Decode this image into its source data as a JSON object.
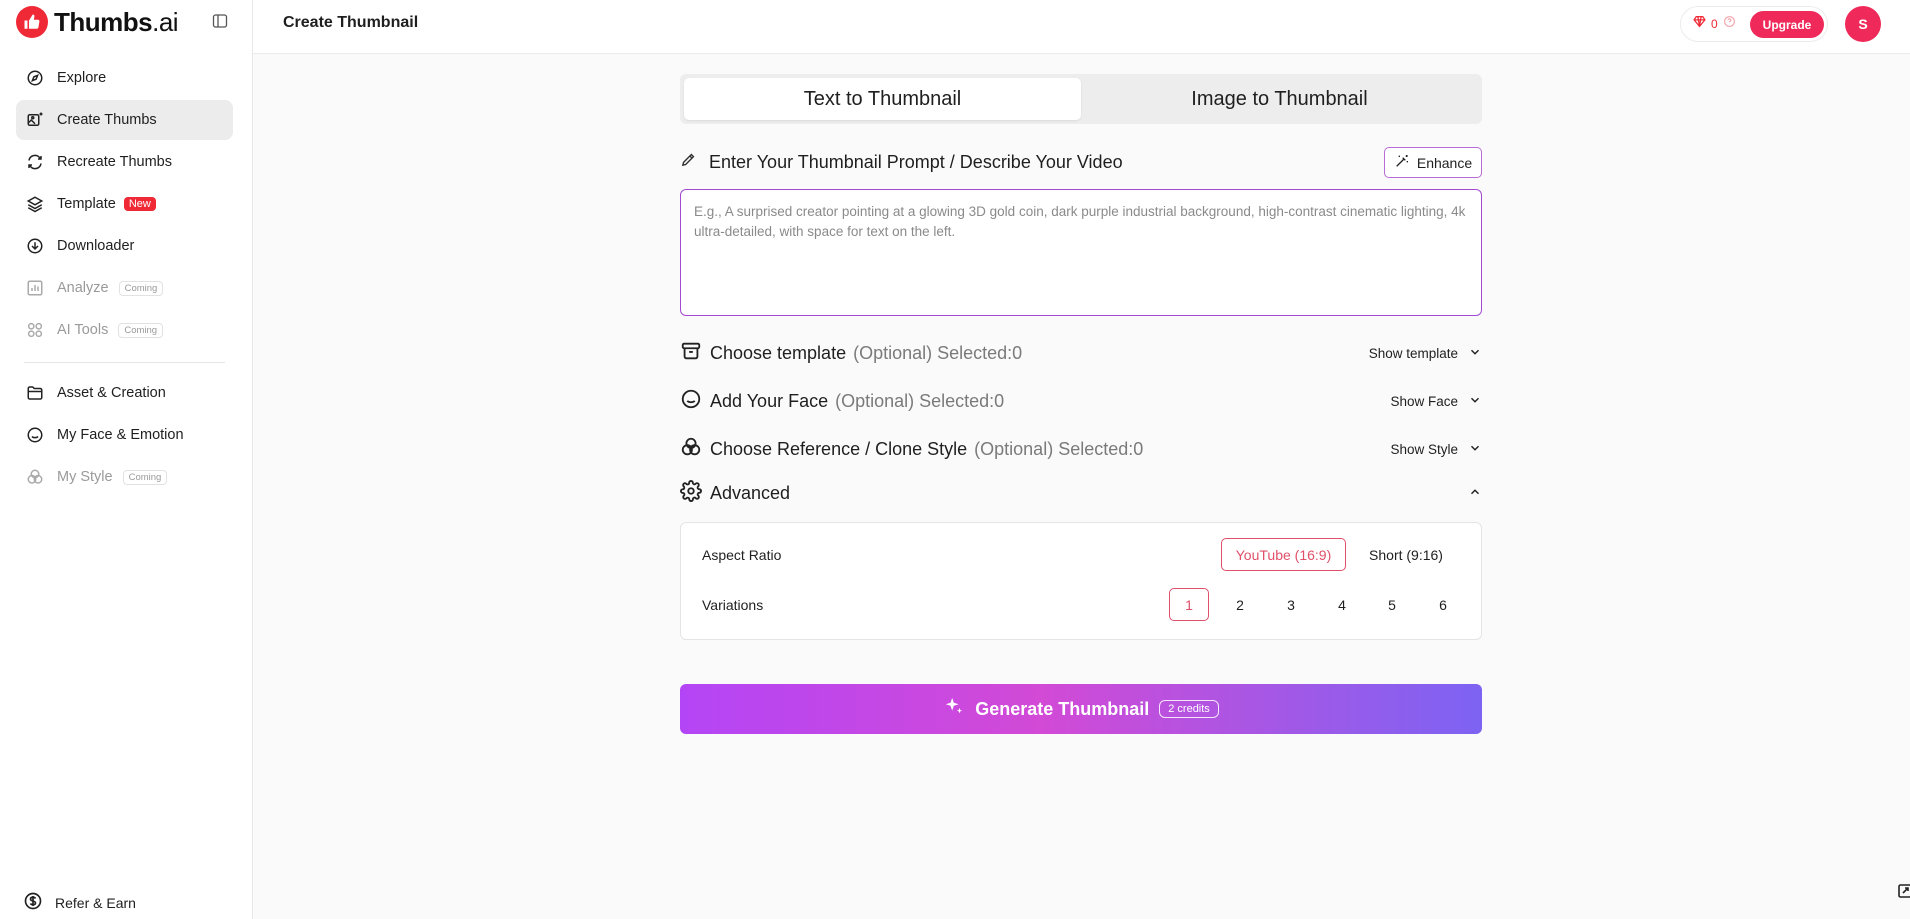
{
  "brand": {
    "name": "Thumbs",
    "suffix": ".ai"
  },
  "header": {
    "title": "Create Thumbnail",
    "credits": "0",
    "upgrade_label": "Upgrade",
    "avatar_initial": "S"
  },
  "sidebar": {
    "items": [
      {
        "label": "Explore",
        "icon": "compass-icon"
      },
      {
        "label": "Create Thumbs",
        "icon": "image-sparkle-icon"
      },
      {
        "label": "Recreate Thumbs",
        "icon": "refresh-icon"
      },
      {
        "label": "Template",
        "icon": "layers-icon",
        "badge": "New"
      },
      {
        "label": "Downloader",
        "icon": "download-circle-icon"
      },
      {
        "label": "Analyze",
        "icon": "bar-chart-icon",
        "badge": "Coming"
      },
      {
        "label": "AI Tools",
        "icon": "grid-circles-icon",
        "badge": "Coming"
      },
      {
        "label": "Asset & Creation",
        "icon": "folder-icon"
      },
      {
        "label": "My Face & Emotion",
        "icon": "face-icon"
      },
      {
        "label": "My Style",
        "icon": "style-circles-icon",
        "badge": "Coming"
      }
    ],
    "refer_label": "Refer & Earn"
  },
  "tabs": [
    {
      "label": "Text to Thumbnail",
      "active": true
    },
    {
      "label": "Image to Thumbnail",
      "active": false
    }
  ],
  "prompt": {
    "label": "Enter Your Thumbnail Prompt / Describe Your Video",
    "enhance_label": "Enhance",
    "placeholder": "E.g., A surprised creator pointing at a glowing 3D gold coin, dark purple industrial background, high-contrast cinematic lighting, 4k ultra-detailed, with space for text on the left.",
    "value": ""
  },
  "options": {
    "template": {
      "title": "Choose template",
      "sub": "(Optional) Selected:0",
      "toggle": "Show template"
    },
    "face": {
      "title": "Add Your Face",
      "sub": "(Optional) Selected:0",
      "toggle": "Show Face"
    },
    "style": {
      "title": "Choose Reference / Clone Style",
      "sub": "(Optional) Selected:0",
      "toggle": "Show Style"
    },
    "advanced": {
      "title": "Advanced"
    }
  },
  "advanced": {
    "aspect_label": "Aspect Ratio",
    "aspect_options": [
      "YouTube (16:9)",
      "Short (9:16)"
    ],
    "aspect_selected": "YouTube (16:9)",
    "variations_label": "Variations",
    "variation_options": [
      "1",
      "2",
      "3",
      "4",
      "5",
      "6"
    ],
    "variation_selected": "1"
  },
  "generate": {
    "label": "Generate Thumbnail",
    "cost": "2 credits"
  },
  "colors": {
    "brand_red": "#ef2a36",
    "accent_pink": "#e0506a",
    "accent_purple": "#a34ad2"
  }
}
